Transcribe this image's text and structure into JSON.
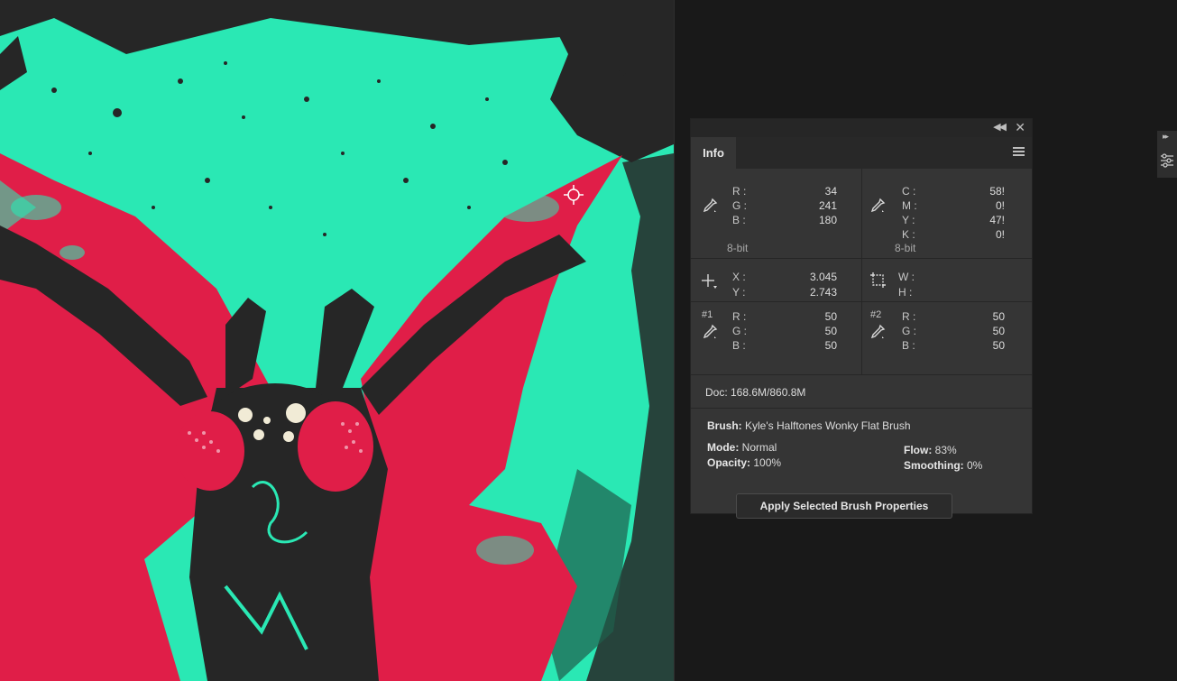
{
  "panel": {
    "tab": "Info",
    "rgb": {
      "labels": [
        "R :",
        "G :",
        "B :"
      ],
      "values": [
        "34",
        "241",
        "180"
      ],
      "bit_depth": "8-bit"
    },
    "cmyk": {
      "labels": [
        "C :",
        "M :",
        "Y :",
        "K :"
      ],
      "values": [
        "58!",
        "0!",
        "47!",
        "0!"
      ],
      "bit_depth": "8-bit"
    },
    "position": {
      "labels": [
        "X :",
        "Y :"
      ],
      "values": [
        "3.045",
        "2.743"
      ]
    },
    "size": {
      "labels": [
        "W :",
        "H :"
      ],
      "values": [
        "",
        ""
      ]
    },
    "sampler1": {
      "id": "#1",
      "labels": [
        "R :",
        "G :",
        "B :"
      ],
      "values": [
        "50",
        "50",
        "50"
      ]
    },
    "sampler2": {
      "id": "#2",
      "labels": [
        "R :",
        "G :",
        "B :"
      ],
      "values": [
        "50",
        "50",
        "50"
      ]
    },
    "doc": "Doc:  168.6M/860.8M",
    "brush": {
      "brush_label": "Brush:",
      "brush_name": "Kyle's Halftones Wonky Flat Brush",
      "mode_label": "Mode:",
      "mode_value": "Normal",
      "opacity_label": "Opacity:",
      "opacity_value": "100%",
      "flow_label": "Flow:",
      "flow_value": "83%",
      "smoothing_label": "Smoothing:",
      "smoothing_value": "0%",
      "apply_button": "Apply Selected Brush Properties"
    }
  },
  "colors": {
    "canvas_bg": "#2ae8b4",
    "wing_red": "#e01e48",
    "ink": "#262626",
    "panel_bg": "#353535"
  },
  "icons": [
    "eyedropper-icon",
    "crosshair-icon",
    "selection-size-icon",
    "color-sampler-icon",
    "panel-menu-icon",
    "collapse-icon",
    "close-icon",
    "brush-settings-icon"
  ]
}
